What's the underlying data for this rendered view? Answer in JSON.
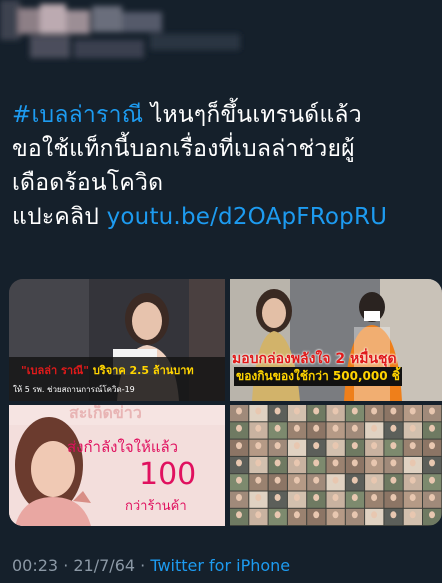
{
  "tweet": {
    "lines": [
      {
        "hashtag": "#เบลล่าราณี",
        "text": " ไหนๆก็ขึ้นเทรนด์แล้ว"
      },
      {
        "text": "ขอใช้แท็กนี้บอกเรื่องที่เบลล่าช่วยผู้"
      },
      {
        "text": "เดือดร้อนโควิด"
      },
      {
        "text": "แปะคลิป ",
        "link": "youtu.be/d2OApFRopRU"
      }
    ]
  },
  "media": {
    "tile1": {
      "caption_name": "\"เบลล่า ราณี\"",
      "caption_action": " บริจาค 2.5 ล้านบาท",
      "caption_sub": "ให้ 5 รพ. ช่วยสถานการณ์โควิด-19"
    },
    "tile2": {
      "caption_top": "มอบกล่องพลังใจ 2 หมื่นชุด",
      "caption_bottom": "ของกินของใช้กว่า 500,000 ชิ้"
    },
    "tile3": {
      "caption_top": "ส่งกำลังใจให้แล้ว",
      "caption_number": "100",
      "caption_bottom": "กว่าร้านค้า",
      "faded_text": "สะเก็ดข่าว"
    },
    "tile4": {}
  },
  "meta": {
    "time": "00:23",
    "separator": " · ",
    "date": "21/7/64",
    "source": "Twitter for iPhone"
  }
}
